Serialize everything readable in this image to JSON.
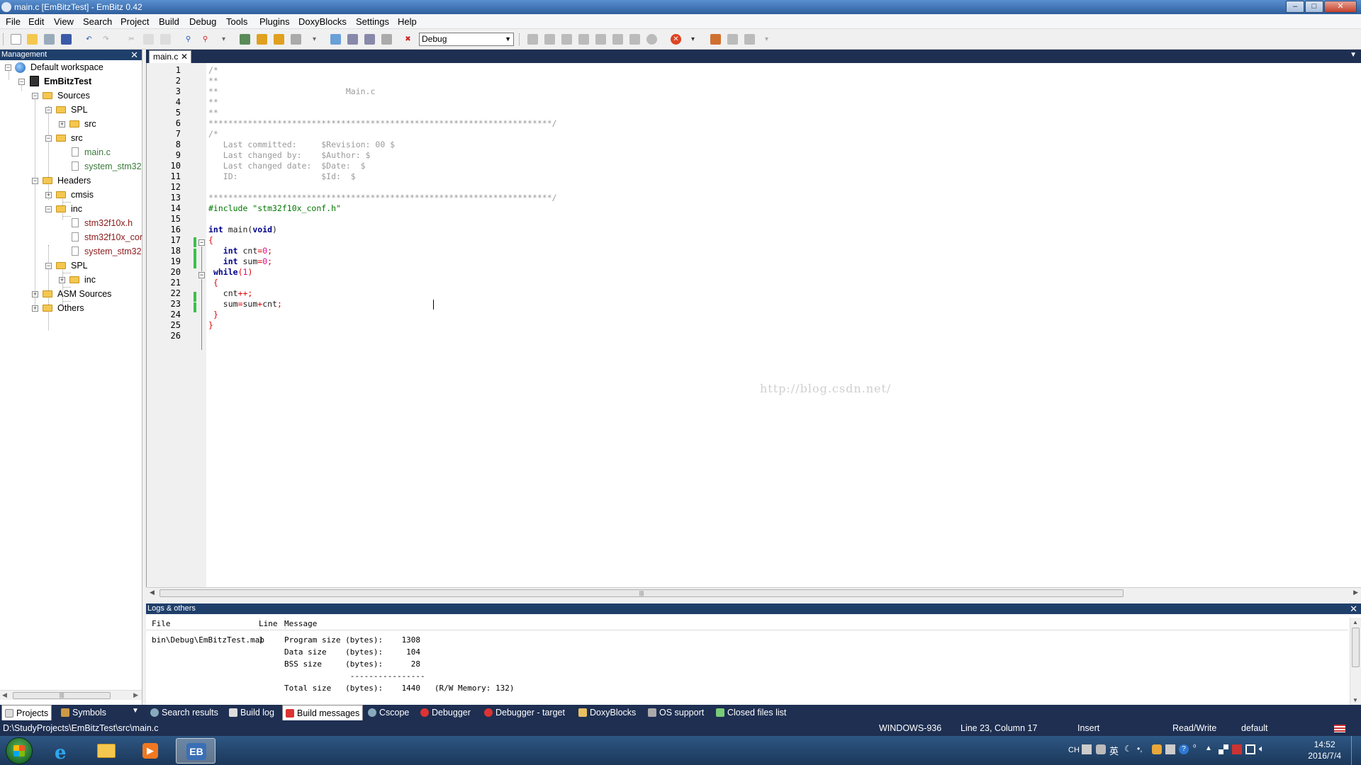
{
  "window": {
    "title": "main.c [EmBitzTest] - EmBitz 0.42",
    "min": "–",
    "max": "□",
    "close": "✕"
  },
  "menu": [
    "File",
    "Edit",
    "View",
    "Search",
    "Project",
    "Build",
    "Debug",
    "Tools",
    "Plugins",
    "DoxyBlocks",
    "Settings",
    "Help"
  ],
  "toolbar": {
    "build_target": "Debug"
  },
  "management": {
    "title": "Management",
    "close": "✕",
    "tree": [
      {
        "label": "Default workspace"
      },
      {
        "label": "EmBitzTest"
      },
      {
        "label": "Sources"
      },
      {
        "label": "SPL"
      },
      {
        "label": "src"
      },
      {
        "label": "src"
      },
      {
        "label": "main.c"
      },
      {
        "label": "system_stm32"
      },
      {
        "label": "Headers"
      },
      {
        "label": "cmsis"
      },
      {
        "label": "inc"
      },
      {
        "label": "stm32f10x.h"
      },
      {
        "label": "stm32f10x_cor"
      },
      {
        "label": "system_stm32"
      },
      {
        "label": "SPL"
      },
      {
        "label": "inc"
      },
      {
        "label": "ASM Sources"
      },
      {
        "label": "Others"
      }
    ],
    "scroll_marker": "|||"
  },
  "editor": {
    "tab": "main.c",
    "tab_close": "✕",
    "line_numbers": [
      "1",
      "2",
      "3",
      "4",
      "5",
      "6",
      "7",
      "8",
      "9",
      "10",
      "11",
      "12",
      "13",
      "14",
      "15",
      "16",
      "17",
      "18",
      "19",
      "20",
      "21",
      "22",
      "23",
      "24",
      "25",
      "26"
    ],
    "code": {
      "l1": "/*",
      "l2": "**",
      "l3": "**                          Main.c",
      "l4": "**",
      "l5": "**",
      "l6": "**********************************************************************/",
      "l7": "/*",
      "l8": "   Last committed:     $Revision: 00 $",
      "l9": "   Last changed by:    $Author: $",
      "l10": "   Last changed date:  $Date:  $",
      "l11": "   ID:                 $Id:  $",
      "l13": "**********************************************************************/",
      "l14": "#include \"stm32f10x_conf.h\"",
      "l16_kw": "int",
      "l16_rest": " main(",
      "l16_kw2": "void",
      "l16_end": ")",
      "l17": "{",
      "l18_kw": "int",
      "l18_var": " cnt",
      "l18_op": "=",
      "l18_num": "0",
      "l18_end": ";",
      "l19_kw": "int",
      "l19_var": " sum",
      "l19_op": "=",
      "l19_num": "0",
      "l19_end": ";",
      "l20_kw": "while",
      "l20_open": "(",
      "l20_num": "1",
      "l20_close": ")",
      "l21": "{",
      "l22_var": "cnt",
      "l22_op": "++",
      "l22_end": ";",
      "l23_a": "sum",
      "l23_op1": "=",
      "l23_b": "sum",
      "l23_op2": "+",
      "l23_c": "cnt",
      "l23_end": ";",
      "l24": "}",
      "l25": "}"
    },
    "watermark": "http://blog.csdn.net/",
    "scroll_marker": "|||"
  },
  "logs": {
    "title": "Logs & others",
    "close": "✕",
    "col_file": "File",
    "col_line": "Line",
    "col_message": "Message",
    "row_file": "bin\\Debug\\EmBitzTest.map",
    "row_line": "1",
    "messages": [
      "Program size (bytes):    1308",
      "Data size    (bytes):     104",
      "BSS size     (bytes):      28",
      "              ----------------",
      "Total size   (bytes):    1440   (R/W Memory: 132)"
    ]
  },
  "bottom_tabs": [
    "Projects",
    "Symbols",
    "Search results",
    "Build log",
    "Build messages",
    "Cscope",
    "Debugger",
    "Debugger - target",
    "DoxyBlocks",
    "OS support",
    "Closed files list"
  ],
  "status": {
    "path": "D:\\StudyProjects\\EmBitzTest\\src\\main.c",
    "encoding": "WINDOWS-936",
    "position": "Line 23, Column 17",
    "mode": "Insert",
    "access": "Read/Write",
    "profile": "default"
  },
  "taskbar": {
    "ime": "CH",
    "ime_char": "英",
    "time": "14:52",
    "date": "2016/7/4"
  },
  "colors": {
    "dark_panel": "#1e2f52",
    "change_bar": "#3bc14a",
    "keyword": "#00008b",
    "number": "#e00090",
    "preprocessor": "#007800"
  }
}
